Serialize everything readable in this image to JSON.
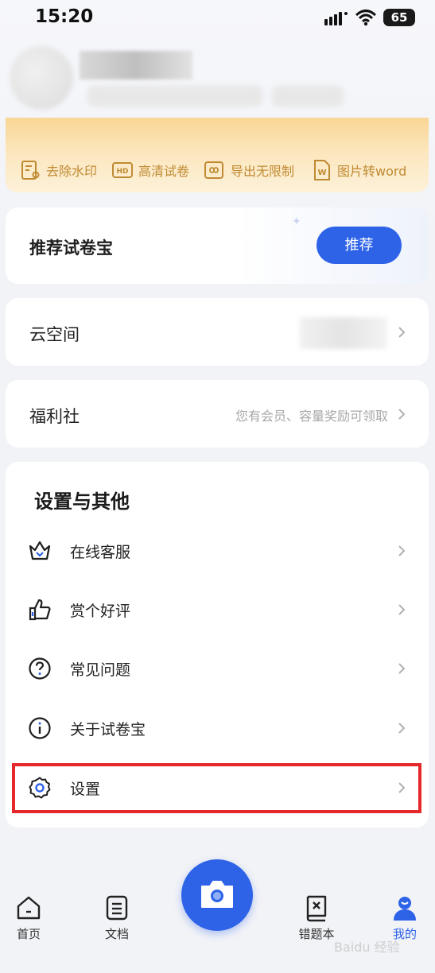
{
  "status_bar": {
    "time": "15:20",
    "battery": "65"
  },
  "vip": {
    "features": [
      {
        "label": "去除水印",
        "icon": "watermark-remove-icon"
      },
      {
        "label": "高清试卷",
        "icon": "hd-icon"
      },
      {
        "label": "导出无限制",
        "icon": "infinity-export-icon"
      },
      {
        "label": "图片转word",
        "icon": "word-icon"
      }
    ]
  },
  "recommend": {
    "title": "推荐试卷宝",
    "button": "推荐"
  },
  "cloud": {
    "title": "云空间"
  },
  "welfare": {
    "title": "福利社",
    "hint": "您有会员、容量奖励可领取"
  },
  "settings_section": {
    "title": "设置与其他",
    "items": [
      {
        "label": "在线客服",
        "icon": "customer-service-icon"
      },
      {
        "label": "赏个好评",
        "icon": "thumbs-up-icon"
      },
      {
        "label": "常见问题",
        "icon": "question-icon"
      },
      {
        "label": "关于试卷宝",
        "icon": "info-icon"
      },
      {
        "label": "设置",
        "icon": "gear-icon"
      }
    ]
  },
  "bottom_nav": {
    "items": [
      {
        "label": "首页",
        "icon": "home-icon"
      },
      {
        "label": "文档",
        "icon": "document-icon"
      },
      {
        "label": "错题本",
        "icon": "mistake-book-icon"
      },
      {
        "label": "我的",
        "icon": "profile-icon"
      }
    ],
    "active_index": 3
  },
  "watermark": "Baidu 经验",
  "colors": {
    "accent": "#2e63e8",
    "vip_text": "#c08a33",
    "highlight": "#e5282a"
  }
}
